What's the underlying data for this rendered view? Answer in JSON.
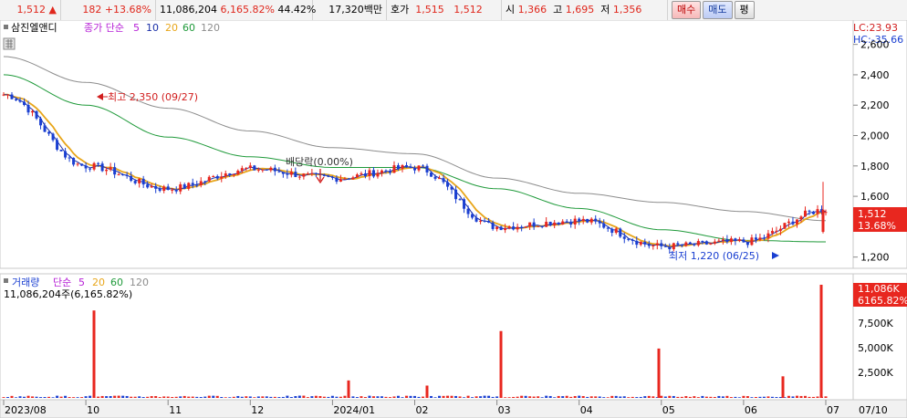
{
  "header": {
    "price": "1,512",
    "change_arrow": "▲",
    "change": "182",
    "change_pct": "+13.68%",
    "volume": "11,086,204",
    "volume_ratio": "6,165.82%",
    "turnover_pct": "44.42%",
    "amount": "17,320백만",
    "quote_label": "호가",
    "ask": "1,515",
    "bid": "1,512",
    "open_label": "시",
    "open": "1,366",
    "high_label": "고",
    "high": "1,695",
    "low_label": "저",
    "low": "1,356",
    "buy_button": "매수",
    "sell_button": "매도",
    "eval_button": "평"
  },
  "price_panel": {
    "stock_name": "삼진엘앤디",
    "ma_label": "종가 단순",
    "ma_periods": [
      "5",
      "10",
      "20",
      "60",
      "120"
    ],
    "ma_colors": [
      "#b61fd6",
      "#1a2fa8",
      "#e8a61a",
      "#1f9a3a",
      "#8d8d8d"
    ],
    "lc": "LC:23.93",
    "hc": "HC:-35.66",
    "current_price_tag": "1,512",
    "current_pct_tag": "13.68%",
    "y_ticks": [
      "2,600",
      "2,400",
      "2,200",
      "2,000",
      "1,800",
      "1,600",
      "1,400",
      "1,200"
    ],
    "ann_high": "최고 2,350 (09/27)",
    "ann_low": "최저 1,220 (06/25)",
    "ann_dividend": "배당락(0.00%)"
  },
  "volume_panel": {
    "label": "거래량",
    "ma_label": "단순",
    "ma_periods": [
      "5",
      "20",
      "60",
      "120"
    ],
    "current_text": "11,086,204주(6,165.82%)",
    "tag_value": "11,086K",
    "tag_pct": "6165.82%",
    "y_ticks": [
      "7,500K",
      "5,000K",
      "2,500K"
    ]
  },
  "x_axis": [
    "2023/08",
    "10",
    "11",
    "12",
    "2024/01",
    "02",
    "03",
    "04",
    "05",
    "06",
    "07",
    "07/10"
  ],
  "chart_data": {
    "type": "line",
    "title": "삼진엘앤디",
    "x": [
      "2023/08",
      "10",
      "11",
      "12",
      "2024/01",
      "02",
      "03",
      "04",
      "05",
      "06",
      "07"
    ],
    "ylim": [
      1150,
      2700
    ],
    "series": [
      {
        "name": "종가",
        "values": [
          2270,
          1800,
          1650,
          1780,
          1720,
          1790,
          1400,
          1440,
          1270,
          1300,
          1512
        ]
      },
      {
        "name": "120",
        "values": [
          2520,
          2350,
          2180,
          2030,
          1920,
          1880,
          1720,
          1620,
          1560,
          1500,
          1440
        ]
      },
      {
        "name": "60",
        "values": [
          2400,
          2200,
          1990,
          1860,
          1790,
          1790,
          1650,
          1520,
          1380,
          1310,
          1300
        ]
      }
    ],
    "volume_ylim": [
      0,
      11000
    ]
  }
}
